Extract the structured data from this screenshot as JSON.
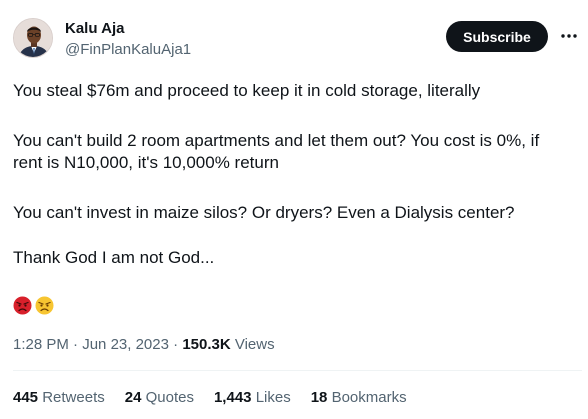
{
  "author": {
    "display_name": "Kalu Aja",
    "handle": "@FinPlanKaluAja1"
  },
  "header": {
    "subscribe_label": "Subscribe",
    "more_icon": "more-icon"
  },
  "tweet": {
    "lines": [
      "You steal $76m and proceed to keep it in cold storage, literally",
      "You can't build 2 room apartments and let them out? You cost is 0%, if",
      "rent is N10,000, it's 10,000% return",
      "You can't invest in maize silos? Or dryers? Even a Dialysis center?",
      "Thank God I am not God..."
    ],
    "emojis": [
      "angry-red-face-emoji",
      "angry-face-emoji"
    ]
  },
  "meta": {
    "time": "1:28 PM",
    "separator": " · ",
    "date": "Jun 23, 2023",
    "views_count": "150.3K",
    "views_label": "Views"
  },
  "stats": {
    "retweets_count": "445",
    "retweets_label": "Retweets",
    "quotes_count": "24",
    "quotes_label": "Quotes",
    "likes_count": "1,443",
    "likes_label": "Likes",
    "bookmarks_count": "18",
    "bookmarks_label": "Bookmarks"
  },
  "colors": {
    "text_primary": "#0f1419",
    "text_secondary": "#536471",
    "button_bg": "#0f1419",
    "divider": "#eff3f4"
  }
}
